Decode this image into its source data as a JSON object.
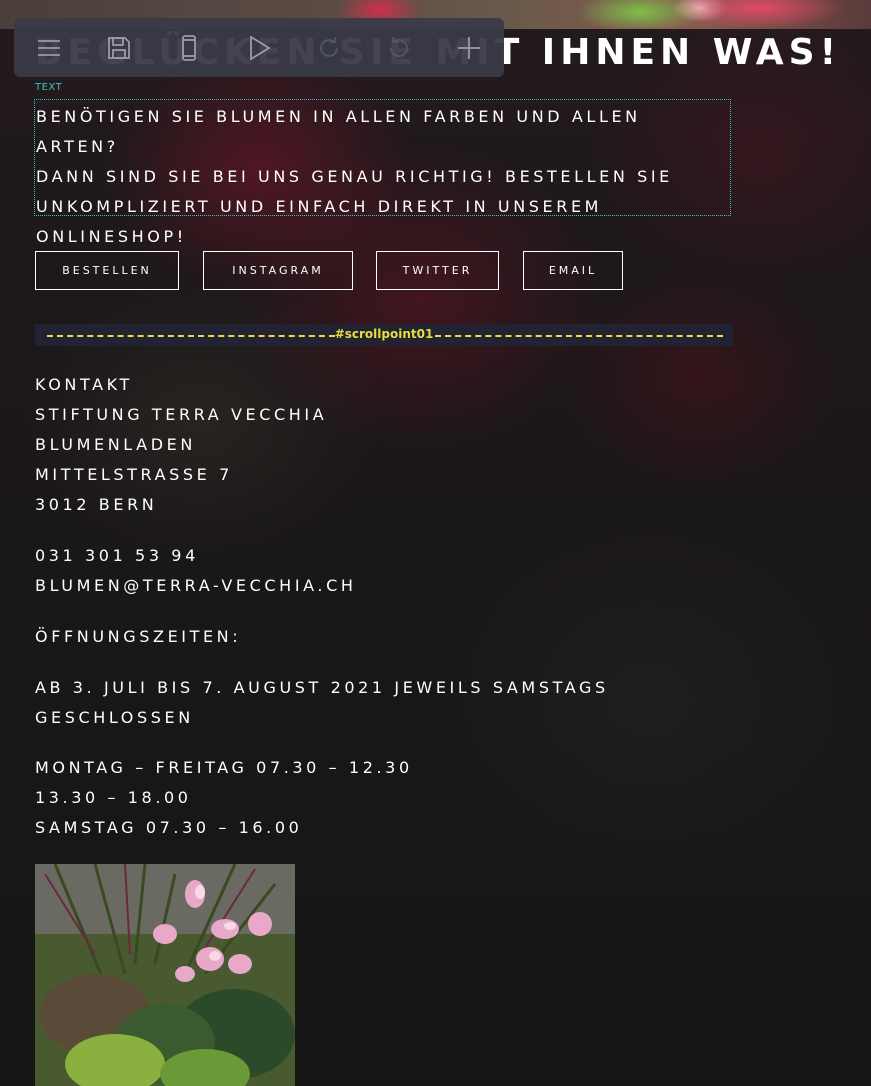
{
  "heading": {
    "text": "BEGLÜCKEN SIE MIT IHNEN WAS!"
  },
  "toolbar": {
    "items": [
      {
        "name": "menu-icon"
      },
      {
        "name": "save-icon"
      },
      {
        "name": "mobile-preview-icon"
      },
      {
        "name": "play-icon"
      },
      {
        "name": "redo-icon"
      },
      {
        "name": "undo-icon"
      },
      {
        "name": "add-icon"
      }
    ]
  },
  "text_block": {
    "tag": "TEXT",
    "lines": [
      "BENÖTIGEN SIE BLUMEN IN ALLEN FARBEN UND ALLEN ARTEN?",
      "DANN SIND SIE BEI UNS GENAU RICHTIG! BESTELLEN SIE",
      "UNKOMPLIZIERT UND EINFACH DIREKT IN UNSEREM",
      "ONLINESHOP!"
    ]
  },
  "buttons": {
    "order": "BESTELLEN",
    "instagram": "INSTAGRAM",
    "twitter": "TWITTER",
    "email": "EMAIL"
  },
  "scrollpoint": {
    "label": "#scrollpoint01"
  },
  "contact": {
    "address": [
      "KONTAKT",
      "STIFTUNG TERRA VECCHIA",
      "BLUMENLADEN",
      "MITTELSTRASSE 7",
      "3012 BERN"
    ],
    "phone": "031 301 53 94",
    "email": "BLUMEN@TERRA-VECCHIA.CH",
    "hours_title": "ÖFFNUNGSZEITEN:",
    "notice": [
      "AB 3. JULI BIS 7. AUGUST 2021 JEWEILS SAMSTAGS",
      "GESCHLOSSEN"
    ],
    "hours": [
      "MONTAG – FREITAG 07.30 – 12.30",
      "13.30 – 18.00",
      "SAMSTAG 07.30 – 16.00"
    ]
  },
  "colors": {
    "toolbar_bg": "#3a3a48",
    "selection_outline": "#3fc0c8",
    "scrollpoint": "#e8dc3c"
  }
}
